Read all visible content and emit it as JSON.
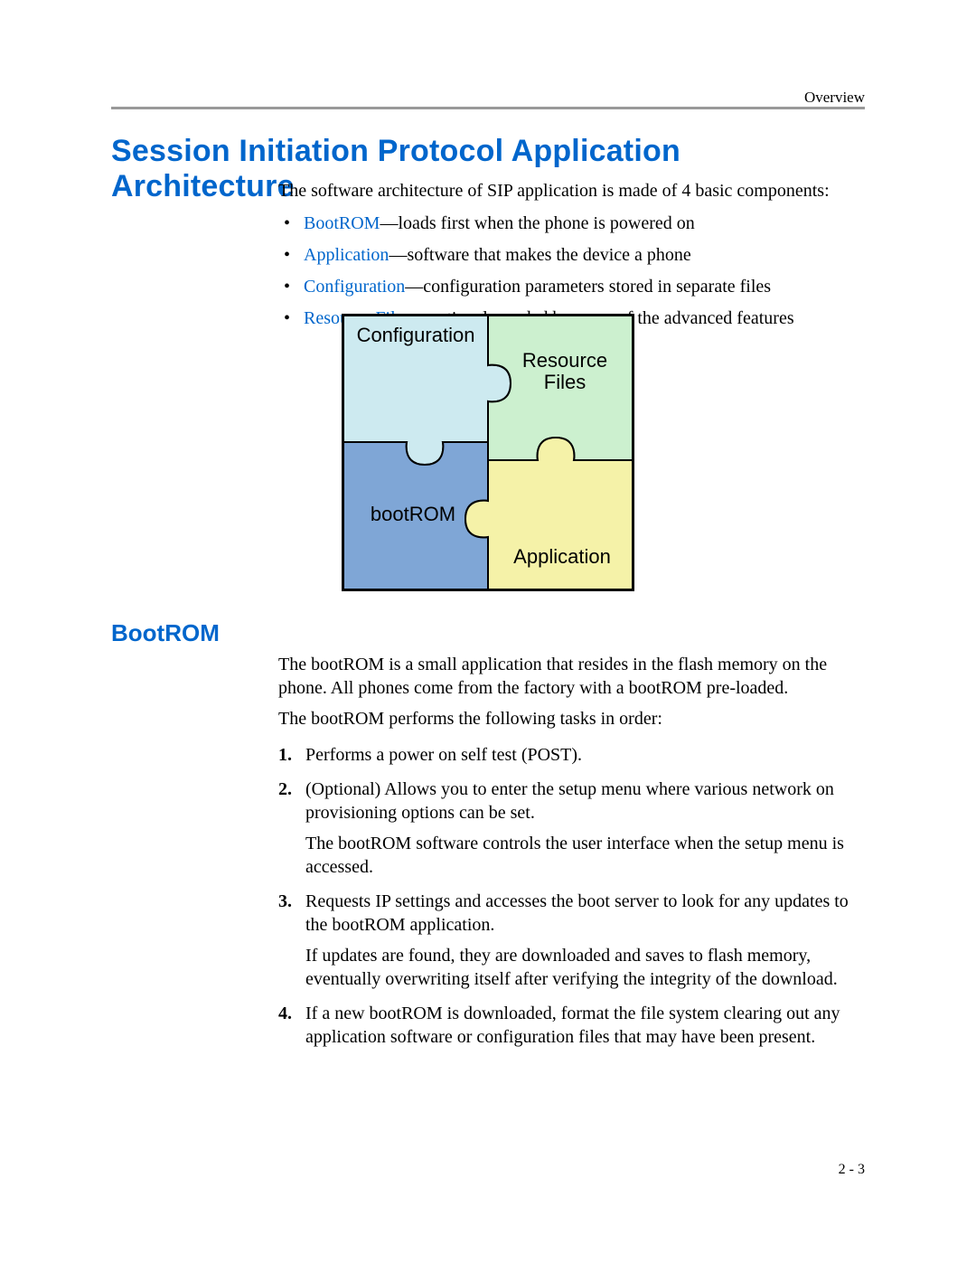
{
  "header": {
    "section": "Overview"
  },
  "title": "Session Initiation Protocol Application Architecture",
  "intro": "The software architecture of SIP application is made of 4 basic components:",
  "components": [
    {
      "name": "BootROM",
      "desc": "—loads first when the phone is powered on"
    },
    {
      "name": "Application",
      "desc": "—software that makes the device a phone"
    },
    {
      "name": "Configuration",
      "desc": "—configuration parameters stored in separate files"
    },
    {
      "name": "Resource Files",
      "desc": "—optional, needed by some of the advanced features"
    }
  ],
  "diagram": {
    "topLeft": "Configuration",
    "topRight1": "Resource",
    "topRight2": "Files",
    "bottomLeft": "bootROM",
    "bottomRight": "Application"
  },
  "subheading": "BootROM",
  "bootrom_p1": "The bootROM is a small application that resides in the flash memory on the phone. All phones come from the factory with a bootROM pre-loaded.",
  "bootrom_p2": "The bootROM performs the following tasks in order:",
  "steps": [
    {
      "n": "1.",
      "text": "Performs a power on self test (POST)."
    },
    {
      "n": "2.",
      "text": "(Optional) Allows you to enter the setup menu where various network on provisioning options can be set.",
      "sub": "The bootROM software controls the user interface when the setup menu is accessed."
    },
    {
      "n": "3.",
      "text": "Requests IP settings and accesses the boot server to look for any updates to the bootROM application.",
      "sub": "If updates are found, they are downloaded and saves to flash memory, eventually overwriting itself after verifying the integrity of the download."
    },
    {
      "n": "4.",
      "text": "If a new bootROM is downloaded, format the file system clearing out any application software or configuration files that may have been present."
    }
  ],
  "footer": "2 - 3"
}
